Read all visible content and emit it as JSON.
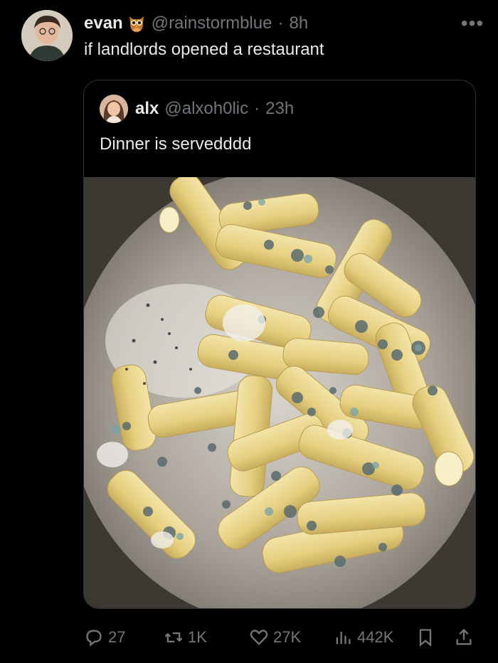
{
  "tweet": {
    "author": {
      "name": "evan",
      "handle": "@rainstormblue",
      "time": "8h",
      "badge_icon": "owl-icon"
    },
    "text": "if landlords opened a restaurant",
    "more_icon": "more-icon"
  },
  "quote": {
    "author": {
      "name": "alx",
      "handle": "@alxoh0lic",
      "time": "23h"
    },
    "text": "Dinner is servedddd",
    "media_description": "moldy rigatoni pasta in a metal pot"
  },
  "actions": {
    "replies": "27",
    "retweets": "1K",
    "likes": "27K",
    "views": "442K"
  },
  "colors": {
    "background": "#000000",
    "text_primary": "#e7e9ea",
    "text_secondary": "#71767b",
    "border": "#2f3336"
  }
}
